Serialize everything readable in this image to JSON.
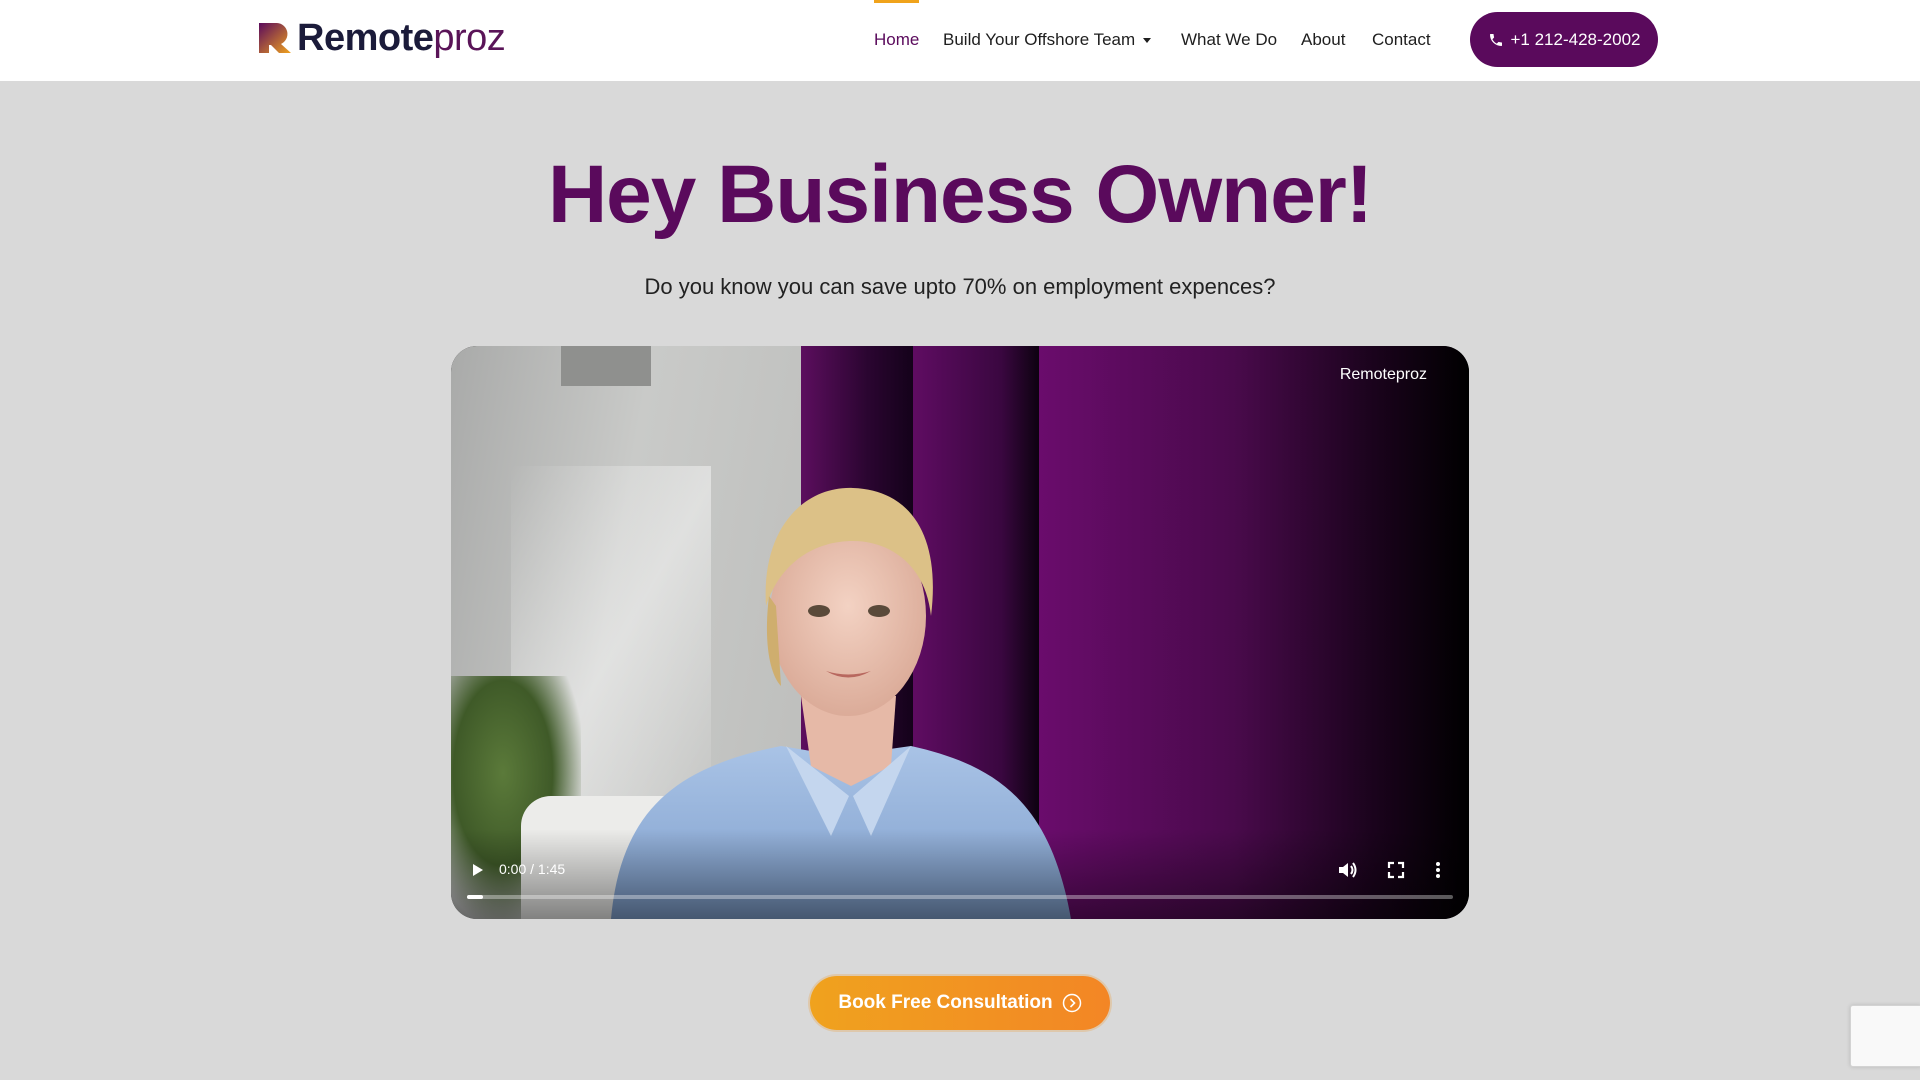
{
  "brand": {
    "name_bold": "Remote",
    "name_light": "proz"
  },
  "nav": {
    "items": [
      {
        "label": "Home",
        "active": true
      },
      {
        "label": "Build Your Offshore Team",
        "has_dropdown": true
      },
      {
        "label": "What We Do"
      },
      {
        "label": "About"
      },
      {
        "label": "Contact"
      }
    ],
    "phone_label": "+1 212-428-2002"
  },
  "hero": {
    "title": "Hey Business Owner!",
    "subtitle": "Do you know you can save upto 70% on employment expences?"
  },
  "video": {
    "watermark": "Remoteproz",
    "time": "0:00 / 1:45",
    "progress": 0.0
  },
  "cta": {
    "label": "Book Free Consultation"
  },
  "colors": {
    "brand_purple": "#5a0a5c",
    "accent_orange": "#f0a21e",
    "page_background": "#d9d9d9"
  },
  "icons": [
    "phone-icon",
    "play-icon",
    "volume-icon",
    "fullscreen-icon",
    "more-vertical-icon",
    "arrow-right-circle-icon"
  ]
}
